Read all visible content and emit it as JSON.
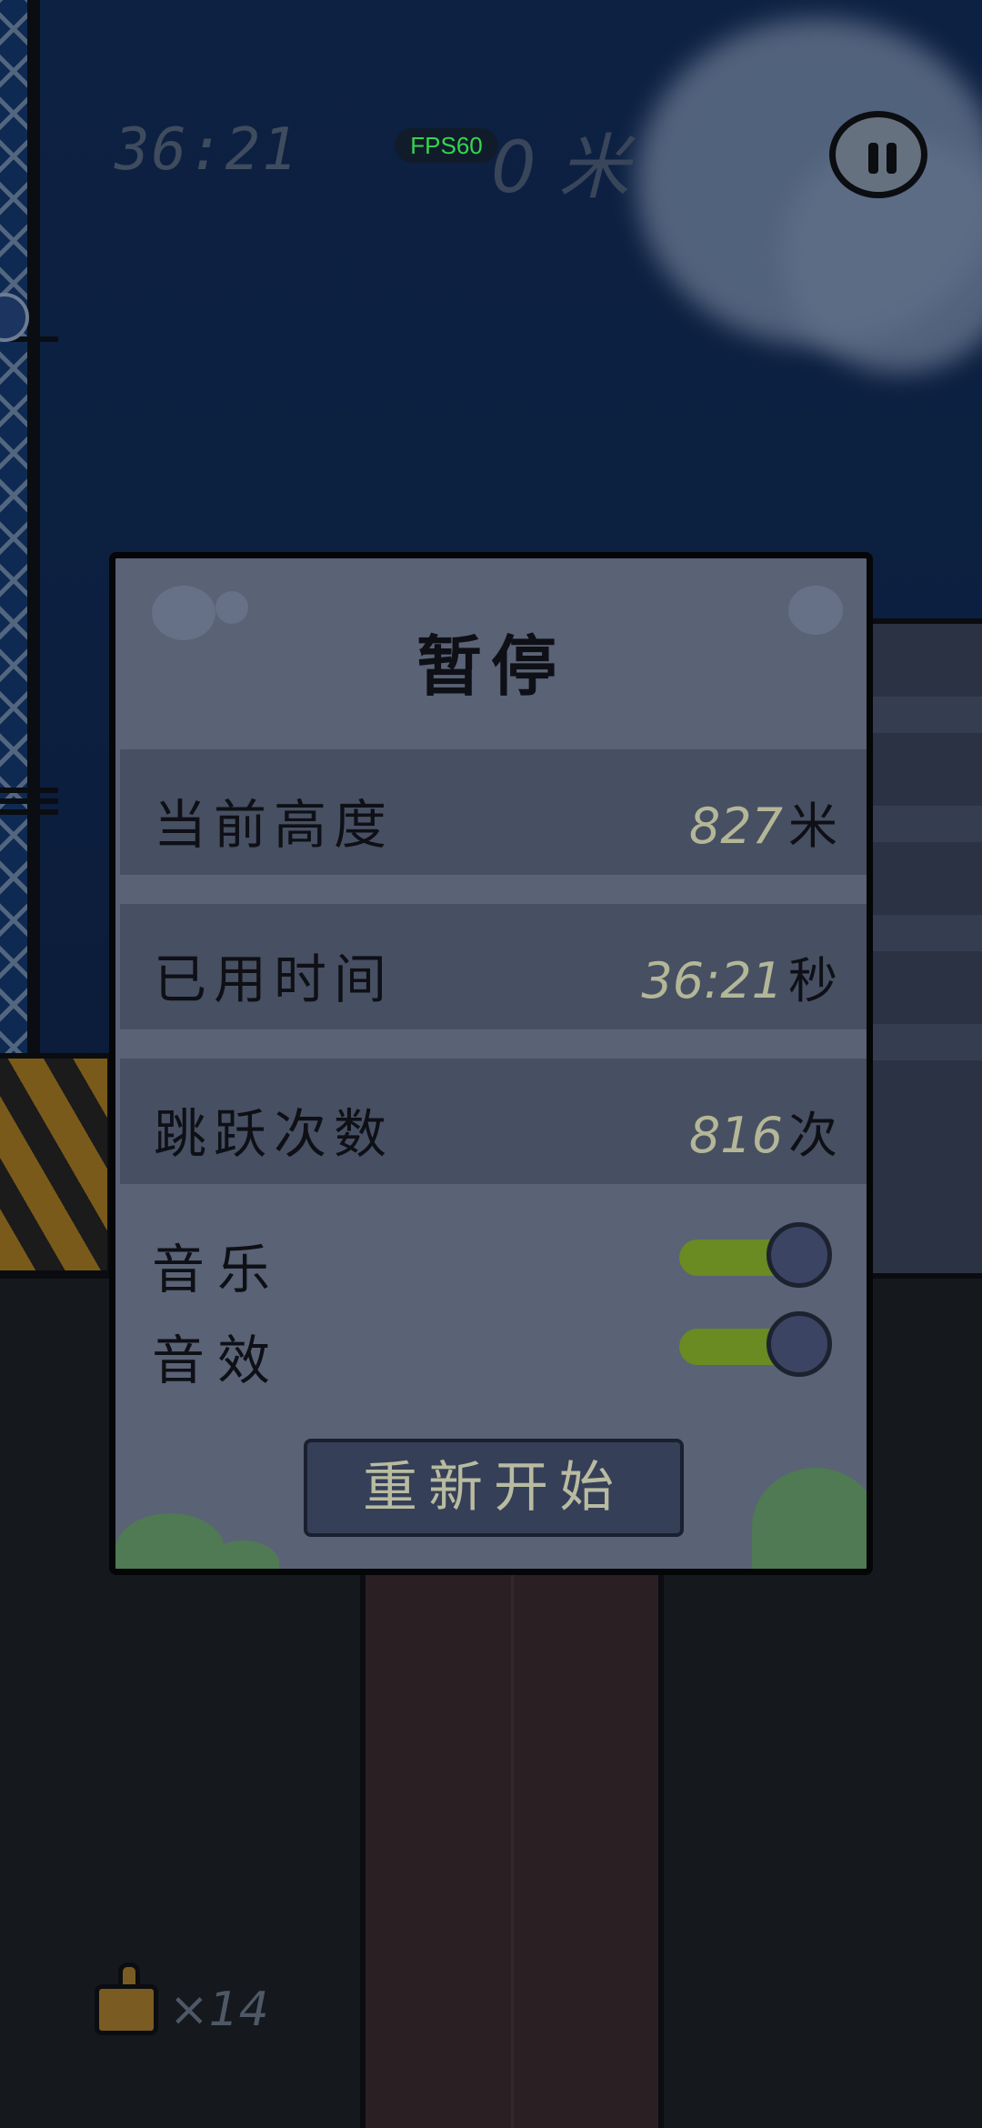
{
  "hud": {
    "time": "36:21",
    "fps": "FPS60",
    "height": "0 米"
  },
  "icons": {
    "pause": "pause-icon",
    "item": "thumbs-up-item-icon"
  },
  "dialog": {
    "title": "暂停",
    "stats": [
      {
        "label": "当前高度",
        "value": "827",
        "unit": "米"
      },
      {
        "label": "已用时间",
        "value": "36:21",
        "unit": "秒"
      },
      {
        "label": "跳跃次数",
        "value": "816",
        "unit": "次"
      }
    ],
    "toggles": [
      {
        "label": "音乐",
        "state": "on"
      },
      {
        "label": "音效",
        "state": "on"
      }
    ],
    "restart_label": "重新开始"
  },
  "inventory": {
    "count": "×14"
  },
  "colors": {
    "sky": "#0c1f3f",
    "dialog_bg": "#5a6276",
    "row_bg": "#474f62",
    "toggle_on": "#6a8a22",
    "fps_text": "#33d64f"
  }
}
